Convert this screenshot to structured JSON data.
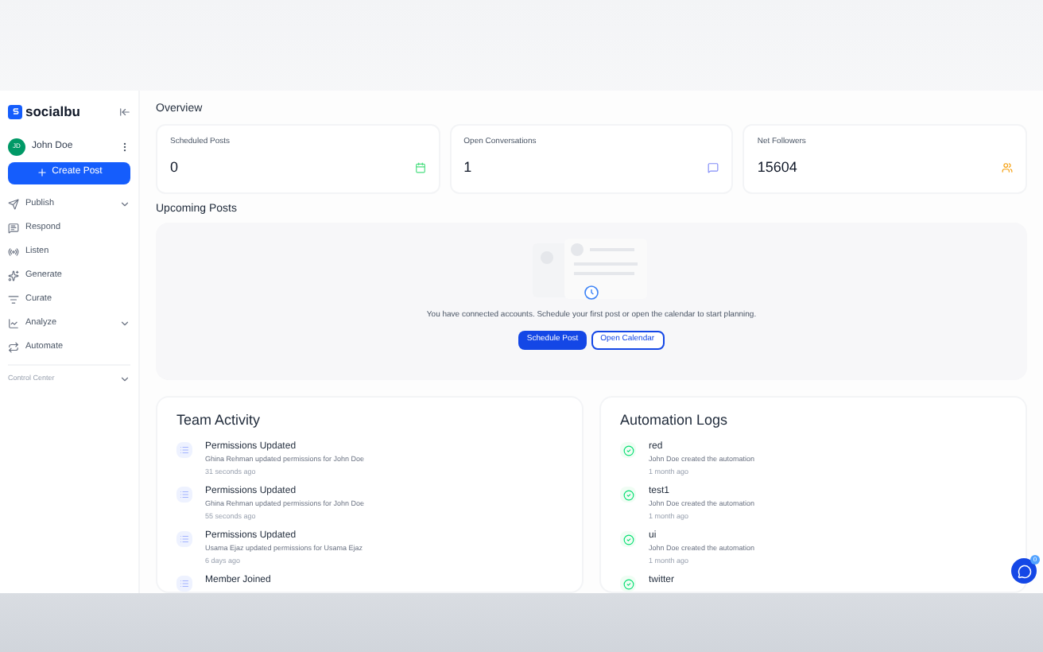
{
  "sidebar": {
    "brand": "socialbu",
    "user": {
      "initials": "JD",
      "name": "John Doe"
    },
    "create_button": "Create Post",
    "items": [
      {
        "label": "Publish",
        "kind": "group"
      },
      {
        "label": "Respond",
        "kind": "link"
      },
      {
        "label": "Listen",
        "kind": "link"
      },
      {
        "label": "Generate",
        "kind": "link"
      },
      {
        "label": "Curate",
        "kind": "link"
      },
      {
        "label": "Analyze",
        "kind": "group"
      },
      {
        "label": "Automate",
        "kind": "link"
      }
    ],
    "section": "Control Center"
  },
  "overview": {
    "title": "Overview",
    "cards": [
      {
        "label": "Scheduled Posts",
        "value": "0"
      },
      {
        "label": "Open Conversations",
        "value": "1"
      },
      {
        "label": "Net Followers",
        "value": "15604"
      }
    ]
  },
  "upcoming": {
    "title": "Upcoming Posts",
    "message": "You have connected accounts. Schedule your first post or open the calendar to start planning.",
    "primary_button": "Schedule Post",
    "secondary_button": "Open Calendar"
  },
  "team_activity": {
    "title": "Team Activity",
    "items": [
      {
        "title": "Permissions Updated",
        "detail": "Ghina Rehman updated permissions for John Doe",
        "time": "31 seconds ago"
      },
      {
        "title": "Permissions Updated",
        "detail": "Ghina Rehman updated permissions for John Doe",
        "time": "55 seconds ago"
      },
      {
        "title": "Permissions Updated",
        "detail": "Usama Ejaz updated permissions for Usama Ejaz",
        "time": "6 days ago"
      },
      {
        "title": "Member Joined"
      }
    ]
  },
  "automation_logs": {
    "title": "Automation Logs",
    "items": [
      {
        "title": "red",
        "detail": "John Doe created the automation",
        "time": "1 month ago"
      },
      {
        "title": "test1",
        "detail": "John Doe created the automation",
        "time": "1 month ago"
      },
      {
        "title": "ui",
        "detail": "John Doe created the automation",
        "time": "1 month ago"
      },
      {
        "title": "twitter"
      }
    ]
  },
  "chat_badge": "0"
}
